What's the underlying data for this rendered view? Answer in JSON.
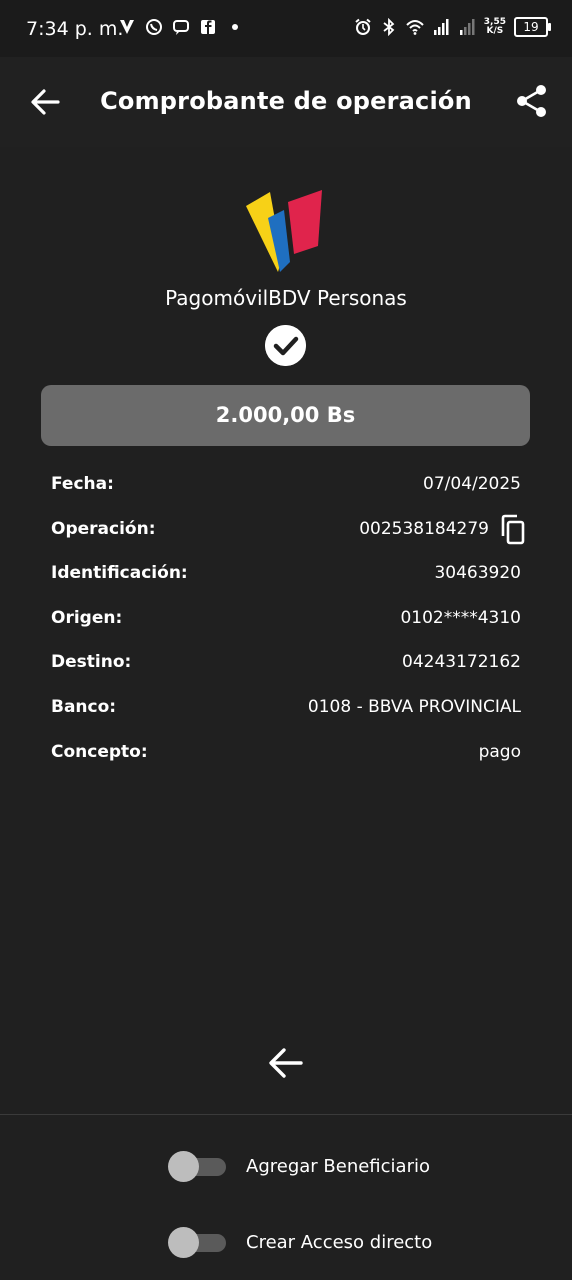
{
  "status_bar": {
    "time": "7:34 p. m.",
    "net_speed_value": "3,55",
    "net_speed_unit": "K/S",
    "battery": "19",
    "icons": [
      "alarm-icon",
      "bluetooth-icon",
      "wifi-icon",
      "signal-icon",
      "signal-icon"
    ],
    "notification_icons": [
      "vpn-icon",
      "whatsapp-icon",
      "chat-icon",
      "facebook-icon",
      "dot-icon"
    ]
  },
  "appbar": {
    "title": "Comprobante de operación"
  },
  "brand": {
    "name": "PagomóvilBDV Personas",
    "colors": {
      "yellow": "#F7D117",
      "blue": "#1F6FC0",
      "red": "#E0244C"
    }
  },
  "amount": "2.000,00 Bs",
  "details": [
    {
      "label": "Fecha:",
      "value": "07/04/2025"
    },
    {
      "label": "Operación:",
      "value": "002538184279"
    },
    {
      "label": "Identificación:",
      "value": "30463920"
    },
    {
      "label": "Origen:",
      "value": "0102****4310"
    },
    {
      "label": "Destino:",
      "value": "04243172162"
    },
    {
      "label": "Banco:",
      "value": "0108 - BBVA PROVINCIAL"
    },
    {
      "label": "Concepto:",
      "value": "pago"
    }
  ],
  "toggles": [
    {
      "label": "Agregar Beneficiario",
      "on": false
    },
    {
      "label": "Crear Acceso directo",
      "on": false
    }
  ]
}
